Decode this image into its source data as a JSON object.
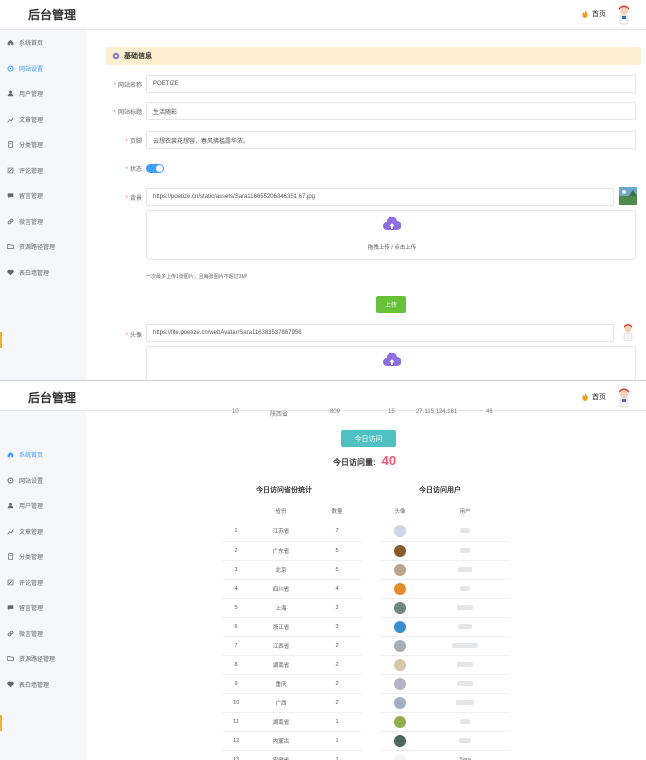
{
  "app_title": "后台管理",
  "home_label": "首页",
  "sidebar": {
    "items": [
      {
        "label": "系统首页",
        "icon": "home-icon"
      },
      {
        "label": "网站设置",
        "icon": "gear-icon"
      },
      {
        "label": "用户管理",
        "icon": "user-icon"
      },
      {
        "label": "文章管理",
        "icon": "chart-icon"
      },
      {
        "label": "分类管理",
        "icon": "document-icon"
      },
      {
        "label": "评论管理",
        "icon": "edit-icon"
      },
      {
        "label": "留言管理",
        "icon": "message-icon"
      },
      {
        "label": "微言管理",
        "icon": "link-icon"
      },
      {
        "label": "资源路径管理",
        "icon": "folder-icon"
      },
      {
        "label": "表白墙管理",
        "icon": "heart-icon"
      }
    ],
    "panel1_active": 1,
    "panel2_active": 0
  },
  "settings": {
    "section_title": "基础信息",
    "site_name_label": "网站名称",
    "site_name": "POETIZE",
    "site_title_label": "网站标题",
    "site_title": "生活随影",
    "footer_label": "页脚",
    "footer": "云想衣裳花想容，春风拂槛露华浓。",
    "status_label": "状态",
    "status_on": true,
    "background_label": "背景",
    "background_url": "https://poetize.cn/static/assets/Sara116655206346351 67.jpg",
    "upload_text": "拖拽上传 / 点击上传",
    "upload_hint": "一次最多上传1张图片，且每张图片不超过3M!",
    "upload_button": "上传",
    "avatar_label": "头像",
    "avatar_url": "https://file.poetize.cn/webAvatar/Sara116383537867956"
  },
  "partial_row": {
    "rank": "10",
    "province": "陕西省",
    "count": "809",
    "index": "15",
    "ip": "27.115.124.161",
    "num": "46"
  },
  "visits": {
    "button": "今日访问",
    "count_label": "今日访问量:",
    "count": "40",
    "province_title": "今日访问省份统计",
    "province_headers": [
      "省份",
      "数量"
    ],
    "provinces": [
      {
        "rank": "1",
        "name": "江苏省",
        "count": "7"
      },
      {
        "rank": "2",
        "name": "广东省",
        "count": "5"
      },
      {
        "rank": "3",
        "name": "北京",
        "count": "5"
      },
      {
        "rank": "4",
        "name": "四川省",
        "count": "4"
      },
      {
        "rank": "5",
        "name": "上海",
        "count": "3"
      },
      {
        "rank": "6",
        "name": "浙江省",
        "count": "3"
      },
      {
        "rank": "7",
        "name": "江西省",
        "count": "2"
      },
      {
        "rank": "8",
        "name": "湖南省",
        "count": "2"
      },
      {
        "rank": "9",
        "name": "重庆",
        "count": "2"
      },
      {
        "rank": "10",
        "name": "广西",
        "count": "2"
      },
      {
        "rank": "11",
        "name": "湖南省",
        "count": "1"
      },
      {
        "rank": "12",
        "name": "内蒙古",
        "count": "1"
      },
      {
        "rank": "13",
        "name": "安徽省",
        "count": "1"
      }
    ],
    "user_title": "今日访问用户",
    "user_headers": [
      "头像",
      "用户"
    ],
    "users": [
      {
        "color": "#c8d6e8",
        "name": ""
      },
      {
        "color": "#8a5a2a",
        "name": ""
      },
      {
        "color": "#b9a58a",
        "name": ""
      },
      {
        "color": "#e48b2a",
        "name": ""
      },
      {
        "color": "#6f8a7a",
        "name": ""
      },
      {
        "color": "#3b8fd0",
        "name": ""
      },
      {
        "color": "#a6b0ba",
        "name": ""
      },
      {
        "color": "#d7c7a8",
        "name": ""
      },
      {
        "color": "#b7b2c8",
        "name": ""
      },
      {
        "color": "#9fb0c4",
        "name": ""
      },
      {
        "color": "#8fb04a",
        "name": ""
      },
      {
        "color": "#4a6a5a",
        "name": ""
      },
      {
        "color": "#f4f4f4",
        "name": "Sara"
      }
    ]
  }
}
